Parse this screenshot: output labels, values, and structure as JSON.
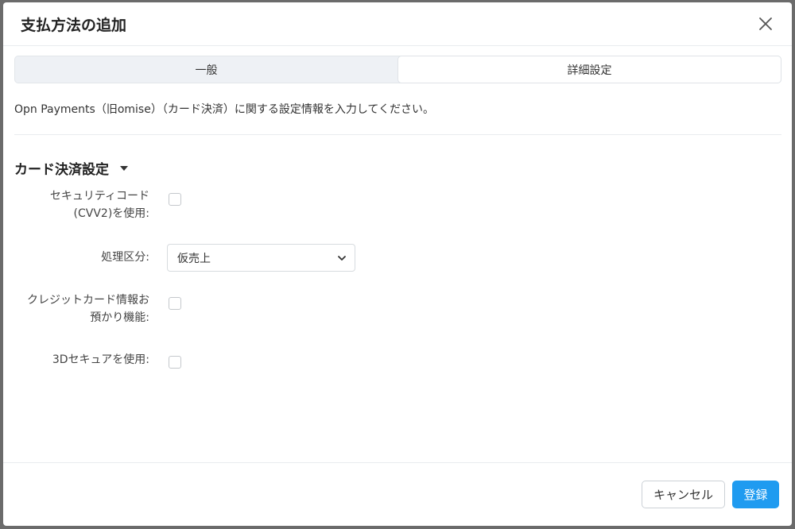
{
  "modal": {
    "title": "支払方法の追加"
  },
  "tabs": [
    {
      "label": "一般",
      "active": false
    },
    {
      "label": "詳細設定",
      "active": true
    }
  ],
  "description": "Opn Payments（旧omise）（カード決済）に関する設定情報を入力してください。",
  "section": {
    "title": "カード決済設定"
  },
  "fields": {
    "security_code": {
      "label_line1": "セキュリティコード",
      "label_line2": "(CVV2)を使用:",
      "checked": false
    },
    "processing_type": {
      "label": "処理区分:",
      "value": "仮売上"
    },
    "card_storage": {
      "label_line1": "クレジットカード情報お",
      "label_line2": "預かり機能:",
      "checked": false
    },
    "secure_3d": {
      "label": "3Dセキュアを使用:",
      "checked": false
    }
  },
  "footer": {
    "cancel_label": "キャンセル",
    "register_label": "登録"
  },
  "colors": {
    "primary": "#1f9bf0",
    "overlay": "#6b6b6b"
  },
  "icons": {
    "close": "close-icon",
    "caret": "caret-down-icon",
    "select_chevron": "chevron-down-icon"
  }
}
